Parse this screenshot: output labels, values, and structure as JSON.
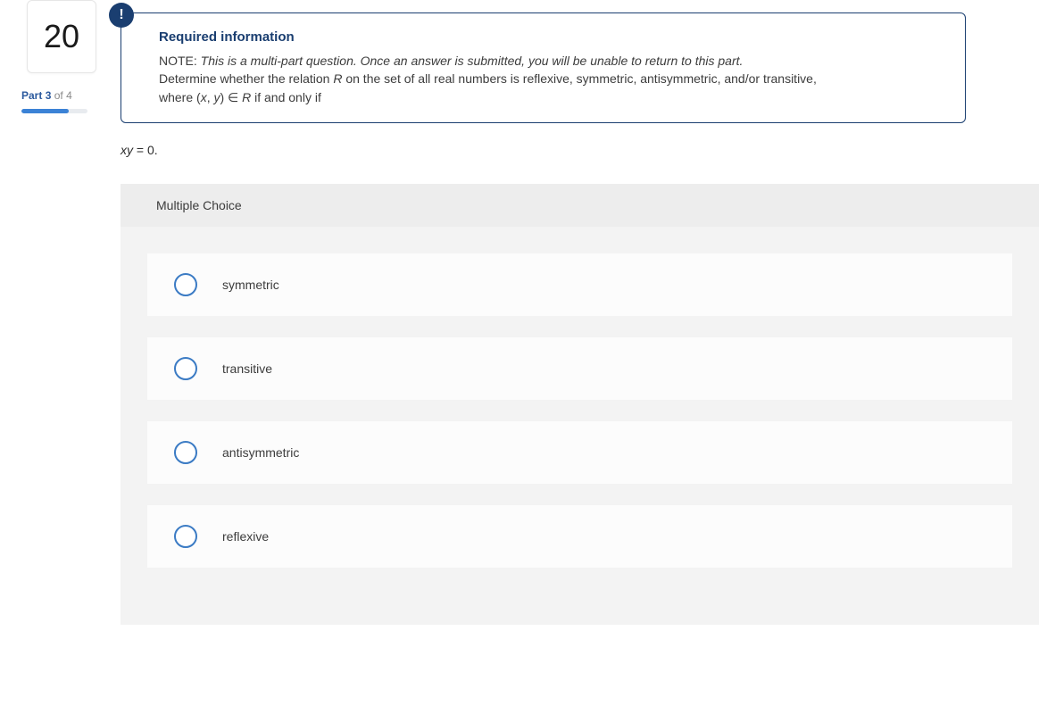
{
  "sidebar": {
    "question_number": "20",
    "part_prefix": "Part ",
    "part_current": "3",
    "part_sep": " of ",
    "part_total": "4",
    "progress_percent": 72
  },
  "info": {
    "badge_glyph": "!",
    "title": "Required information",
    "note_label": "NOTE: ",
    "note_italic": "This is a multi-part question. Once an answer is submitted, you will be unable to return to this part.",
    "body_line1_a": "Determine whether the relation ",
    "body_line1_r": "R",
    "body_line1_b": " on the set of all real numbers is reflexive, symmetric, antisymmetric, and/or transitive,",
    "body_line2_a": "where (",
    "body_line2_x": "x",
    "body_line2_comma": ", ",
    "body_line2_y": "y",
    "body_line2_b": ") ∈ ",
    "body_line2_r": "R",
    "body_line2_c": " if and only if"
  },
  "condition": {
    "xy": "xy",
    "rest": " = 0."
  },
  "mc": {
    "header": "Multiple Choice",
    "options": [
      {
        "label": "symmetric"
      },
      {
        "label": "transitive"
      },
      {
        "label": "antisymmetric"
      },
      {
        "label": "reflexive"
      }
    ]
  }
}
